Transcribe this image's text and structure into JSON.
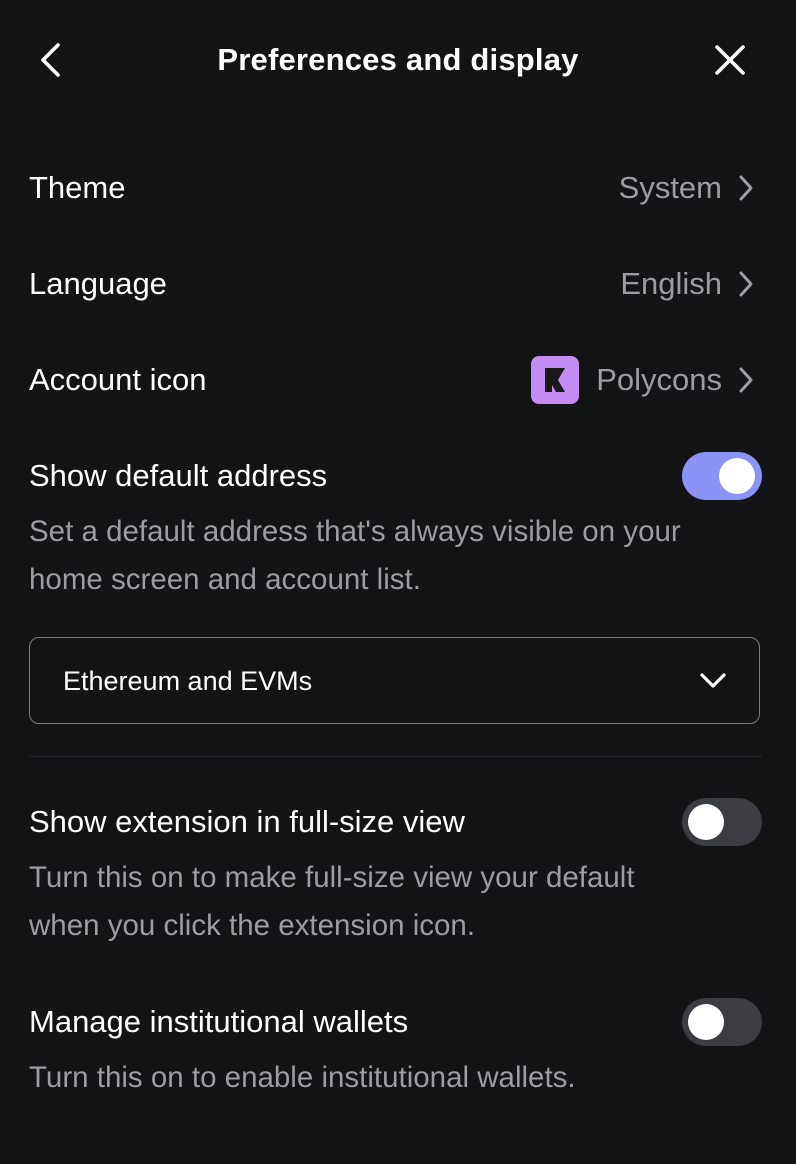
{
  "header": {
    "title": "Preferences and display",
    "back_icon": "chevron-left-icon",
    "close_icon": "close-icon"
  },
  "settings": {
    "theme": {
      "label": "Theme",
      "value": "System"
    },
    "language": {
      "label": "Language",
      "value": "English"
    },
    "account_icon": {
      "label": "Account icon",
      "value": "Polycons",
      "icon": "polycon-icon"
    }
  },
  "default_address": {
    "label": "Show default address",
    "description_line1": "Set a default address that's always visible on your",
    "description_line2": "home screen and account list.",
    "enabled": true,
    "select_value": "Ethereum and EVMs"
  },
  "full_size_view": {
    "label": "Show extension in full-size view",
    "description_line1": "Turn this on to make full-size view your default",
    "description_line2": "when you click the extension icon.",
    "enabled": false
  },
  "institutional_wallets": {
    "label": "Manage institutional wallets",
    "description": "Turn this on to enable institutional wallets.",
    "enabled": false
  },
  "colors": {
    "background": "#131416",
    "toggle_on": "#8b93f7",
    "toggle_off": "#3c3d42",
    "muted_text": "#9b9da1",
    "polycon_tile": "#c68cf5"
  }
}
